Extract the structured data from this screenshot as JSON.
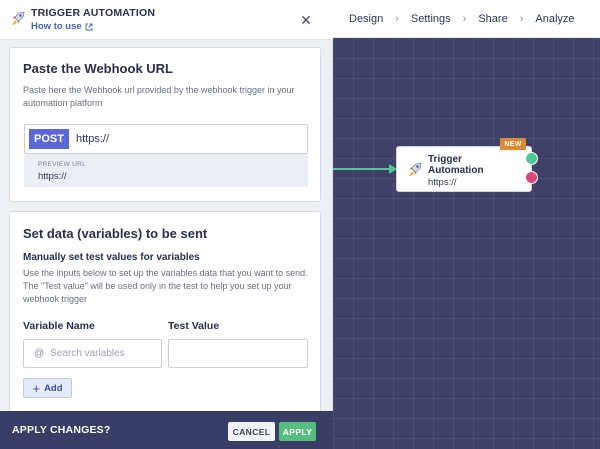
{
  "panel": {
    "title": "TRIGGER AUTOMATION",
    "how_to_use": "How to use",
    "close_symbol": "✕"
  },
  "webhook": {
    "title": "Paste the Webhook URL",
    "description": "Paste here the Webhook url provided by the webhook trigger in your automation platform",
    "method": "POST",
    "url_value": "https://",
    "preview_label": "PREVIEW URL",
    "preview_url": "https://"
  },
  "variables": {
    "title": "Set data (variables) to be sent",
    "subtitle": "Manually set test values for variables",
    "description": "Use the inputs below to set up the variables data that you want to send. The \"Test value\" will be used only in the test to help you set up your webhook trigger",
    "col_name": "Variable Name",
    "col_value": "Test Value",
    "search_placeholder": "Search variables",
    "at_symbol": "@",
    "add_label": "Add",
    "add_symbol": "+"
  },
  "footer": {
    "label": "APPLY CHANGES?",
    "cancel": "CANCEL",
    "apply": "APPLY"
  },
  "nav": {
    "steps": [
      "Design",
      "Settings",
      "Share",
      "Analyze"
    ],
    "separator": "›"
  },
  "node": {
    "title": "Trigger Automation",
    "url": "https://",
    "badge": "NEW"
  },
  "colors": {
    "accent": "#5c67d6",
    "apply": "#57bd7e",
    "canvas": "#3e4067",
    "port_success": "#52c79a",
    "port_error": "#d94a7a",
    "badge": "#dd8a35"
  },
  "icons": {
    "header": "rocket-icon",
    "how_to_use": "external-link-icon",
    "close": "close-icon",
    "node": "rocket-icon"
  }
}
